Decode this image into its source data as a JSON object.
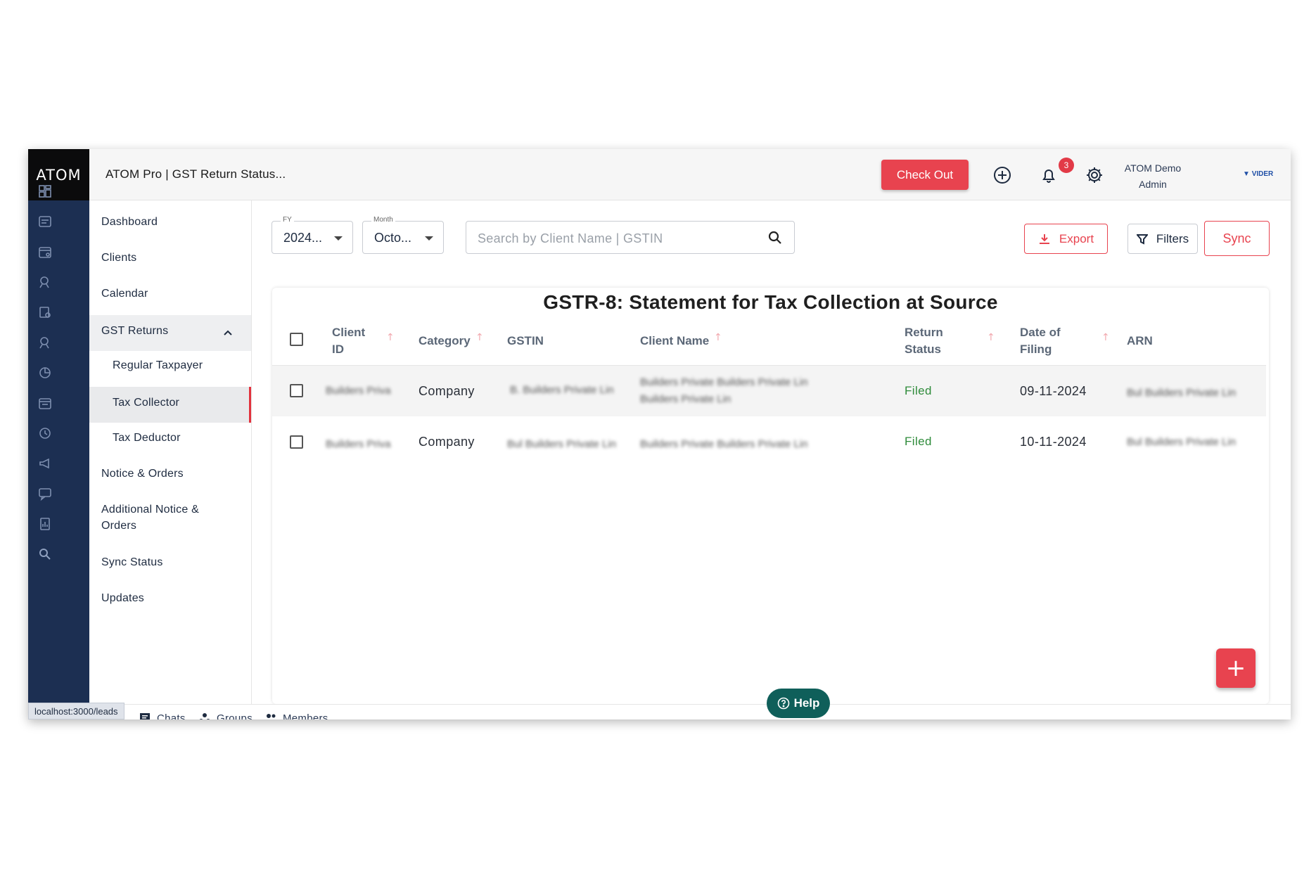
{
  "brand": {
    "logo": "ATOM",
    "partner": "VIDER"
  },
  "header": {
    "title": "ATOM Pro | GST Return Status...",
    "checkout_label": "Check Out",
    "notification_count": "3",
    "user_name": "ATOM Demo",
    "user_role": "Admin"
  },
  "sidebar": {
    "items": [
      {
        "label": "Dashboard"
      },
      {
        "label": "Clients"
      },
      {
        "label": "Calendar"
      },
      {
        "label": "GST Returns"
      },
      {
        "label": "Regular Taxpayer"
      },
      {
        "label": "Tax Collector"
      },
      {
        "label": "Tax Deductor"
      },
      {
        "label": "Notice & Orders"
      },
      {
        "label": "Additional Notice &"
      },
      {
        "label": "Orders"
      },
      {
        "label": "Sync Status"
      },
      {
        "label": "Updates"
      }
    ],
    "active": "Tax Collector"
  },
  "filters": {
    "fy_label": "FY",
    "fy_value": "2024...",
    "month_label": "Month",
    "month_value": "Octo...",
    "search_placeholder": "Search by Client Name | GSTIN",
    "export_label": "Export",
    "filters_label": "Filters",
    "sync_label": "Sync"
  },
  "table": {
    "title": "GSTR-8: Statement for Tax Collection at Source",
    "columns": {
      "client_id_1": "Client",
      "client_id_2": "ID",
      "category": "Category",
      "gstin": "GSTIN",
      "client_name": "Client Name",
      "return_status_1": "Return",
      "return_status_2": "Status",
      "date_1": "Date of",
      "date_2": "Filing",
      "arn": "ARN"
    },
    "rows": [
      {
        "category": "Company",
        "status": "Filed",
        "date": "09-11-2024"
      },
      {
        "category": "Company",
        "status": "Filed",
        "date": "10-11-2024"
      }
    ]
  },
  "bottom_bar": {
    "chats": "Chats",
    "groups": "Groups",
    "members": "Members",
    "help": "Help"
  },
  "status_url": "localhost:3000/leads",
  "colors": {
    "accent": "#e8434f",
    "rail": "#1c2f52",
    "filed": "#2e8b3a",
    "help": "#0f5f5a"
  }
}
